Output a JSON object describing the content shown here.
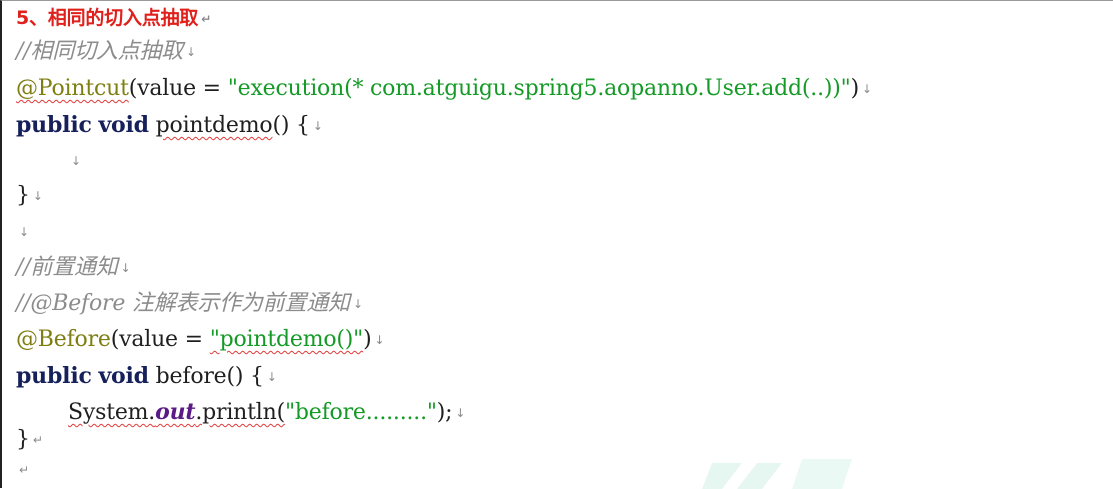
{
  "heading": "5、相同的切入点抽取",
  "comment1": "//相同切入点抽取",
  "pointcut_annotation": "@Pointcut",
  "pointcut_open": "(value = ",
  "pointcut_expr": "\"execution(* com.atguigu.spring5.aopanno.User.add(..))\"",
  "pointcut_close": ")",
  "kw_public": "public",
  "kw_void": "void",
  "pointdemo_name": "pointdemo",
  "pointdemo_sig": "() {",
  "close_brace": "}",
  "comment2": "//前置通知",
  "comment3": "//@Before 注解表示作为前置通知",
  "before_annotation": "@Before",
  "before_open": "(value = ",
  "before_expr": "\"pointdemo()\"",
  "before_close": ")",
  "before_name": "before",
  "before_sig": "() {",
  "sys_class": "System.",
  "sys_field": "out",
  "sys_method": ".println(",
  "sys_arg": "\"before.........\"",
  "sys_end": ");",
  "marks": {
    "arrow": "↓",
    "return": "↵"
  }
}
